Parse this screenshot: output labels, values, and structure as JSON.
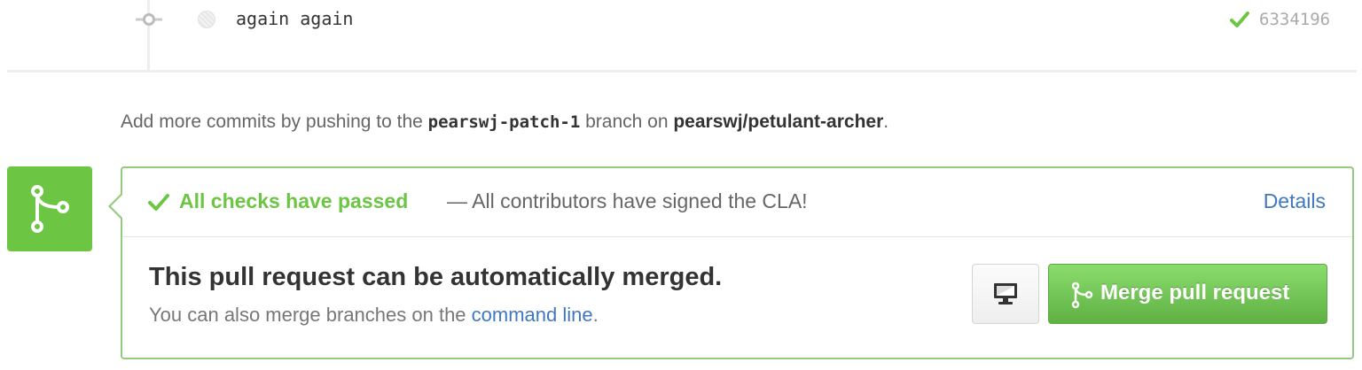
{
  "commit": {
    "message": "again again",
    "status_icon": "check-icon",
    "sha": "6334196"
  },
  "push_note": {
    "prefix": "Add more commits by pushing to the ",
    "branch": "pearswj-patch-1",
    "middle": " branch on ",
    "repo": "pearswj/petulant-archer",
    "suffix": "."
  },
  "merge_badge": {
    "icon": "git-merge-icon"
  },
  "checks": {
    "title": "All checks have passed",
    "separator": " — ",
    "description": "All contributors have signed the CLA!",
    "details_label": "Details"
  },
  "merge": {
    "title": "This pull request can be automatically merged.",
    "subtitle_prefix": "You can also merge branches on the ",
    "subtitle_link": "command line",
    "subtitle_suffix": ".",
    "cli_icon": "monitor-icon",
    "button_label": "Merge pull request",
    "button_icon": "git-merge-icon"
  },
  "colors": {
    "success": "#6cc644",
    "link": "#4078c0",
    "border": "#95c97e"
  }
}
